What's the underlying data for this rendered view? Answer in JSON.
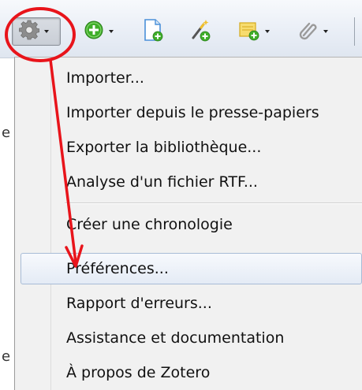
{
  "toolbar": {
    "buttons": [
      {
        "name": "gear",
        "has_dropdown": true,
        "pressed": true
      },
      {
        "name": "add-circle",
        "has_dropdown": true
      },
      {
        "name": "new-document",
        "has_dropdown": false
      },
      {
        "name": "magic-wand",
        "has_dropdown": false
      },
      {
        "name": "new-note",
        "has_dropdown": true
      },
      {
        "name": "paperclip",
        "has_dropdown": true
      }
    ],
    "colors": {
      "gear": "#8c8c8c",
      "add": "#3fae29",
      "document": "#4a90d9",
      "note": "#f2c12e",
      "paperclip": "#9a9a9a"
    }
  },
  "left_strip": {
    "letters": [
      "e",
      "e"
    ]
  },
  "menu": {
    "items": [
      {
        "label": "Importer..."
      },
      {
        "label": "Importer depuis le presse-papiers"
      },
      {
        "label": "Exporter la bibliothèque..."
      },
      {
        "label": "Analyse d'un fichier RTF..."
      },
      {
        "label": "Créer une chronologie"
      },
      {
        "label": "Préférences...",
        "highlighted": true
      },
      {
        "label": "Rapport d'erreurs..."
      },
      {
        "label": "Assistance et documentation"
      },
      {
        "label": "À propos de Zotero"
      }
    ]
  },
  "annotation": {
    "color": "#e8141b"
  }
}
